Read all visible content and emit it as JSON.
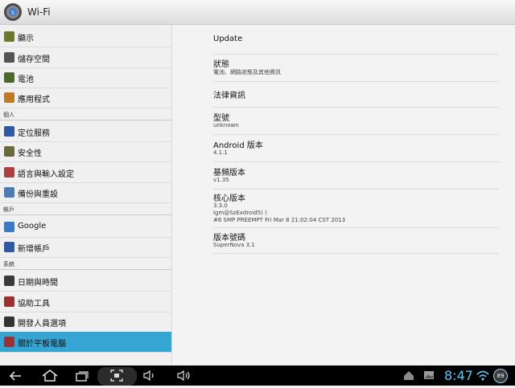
{
  "titlebar": {
    "title": "Wi-Fi",
    "icon": "settings-icon"
  },
  "sidebar": {
    "items_top": [
      {
        "label": "顯示",
        "icon": "display-icon",
        "color": "#6a7a2a"
      },
      {
        "label": "儲存空間",
        "icon": "storage-icon",
        "color": "#555555"
      },
      {
        "label": "電池",
        "icon": "battery-icon",
        "color": "#4a6a2a"
      },
      {
        "label": "應用程式",
        "icon": "apps-icon",
        "color": "#c07a20"
      }
    ],
    "section_personal": "個人",
    "items_personal": [
      {
        "label": "定位服務",
        "icon": "location-icon",
        "color": "#2a5aa8"
      },
      {
        "label": "安全性",
        "icon": "lock-icon",
        "color": "#6a6a3a"
      },
      {
        "label": "語言與輸入設定",
        "icon": "language-icon",
        "color": "#b04040"
      },
      {
        "label": "備份與重設",
        "icon": "backup-icon",
        "color": "#4a7ab8"
      }
    ],
    "section_accounts": "帳戶",
    "items_accounts": [
      {
        "label": "Google",
        "icon": "google-icon",
        "color": "#3a78c8"
      },
      {
        "label": "新增帳戶",
        "icon": "add-account-icon",
        "color": "#2a5aa8"
      }
    ],
    "section_system": "系統",
    "items_system": [
      {
        "label": "日期與時間",
        "icon": "clock-icon",
        "color": "#3a3a3a"
      },
      {
        "label": "協助工具",
        "icon": "accessibility-icon",
        "color": "#a03030"
      },
      {
        "label": "開發人員選項",
        "icon": "developer-icon",
        "color": "#333333"
      },
      {
        "label": "關於平板電腦",
        "icon": "about-icon",
        "color": "#a03030",
        "selected": true
      }
    ]
  },
  "content": {
    "rows": [
      {
        "title": "Update",
        "lines": []
      },
      {
        "title": "狀態",
        "lines": [
          "電池、網路狀態及其他資訊"
        ]
      },
      {
        "title": "法律資訊",
        "lines": []
      },
      {
        "title": "型號",
        "lines": [
          "unknown"
        ]
      },
      {
        "title": "Android 版本",
        "lines": [
          "4.1.1"
        ]
      },
      {
        "title": "基頻版本",
        "lines": [
          "v1.35"
        ]
      },
      {
        "title": "核心版本",
        "lines": [
          "3.3.0",
          "lgm@SzExdroid5) )",
          "#6 SMP PREEMPT Fri Mar 8 21:02:04 CST 2013"
        ]
      },
      {
        "title": "版本號碼",
        "lines": [
          "SuperNova 3.1"
        ]
      }
    ]
  },
  "statusbar": {
    "time": "8:47",
    "battery": "89",
    "accent": "#5ec4f0",
    "nav_buttons": [
      "back-icon",
      "home-icon",
      "recent-apps-icon",
      "screenshot-icon",
      "volume-down-icon",
      "volume-up-icon"
    ],
    "status_icons": [
      "home-status-icon",
      "image-icon",
      "wifi-icon",
      "battery-icon"
    ]
  }
}
